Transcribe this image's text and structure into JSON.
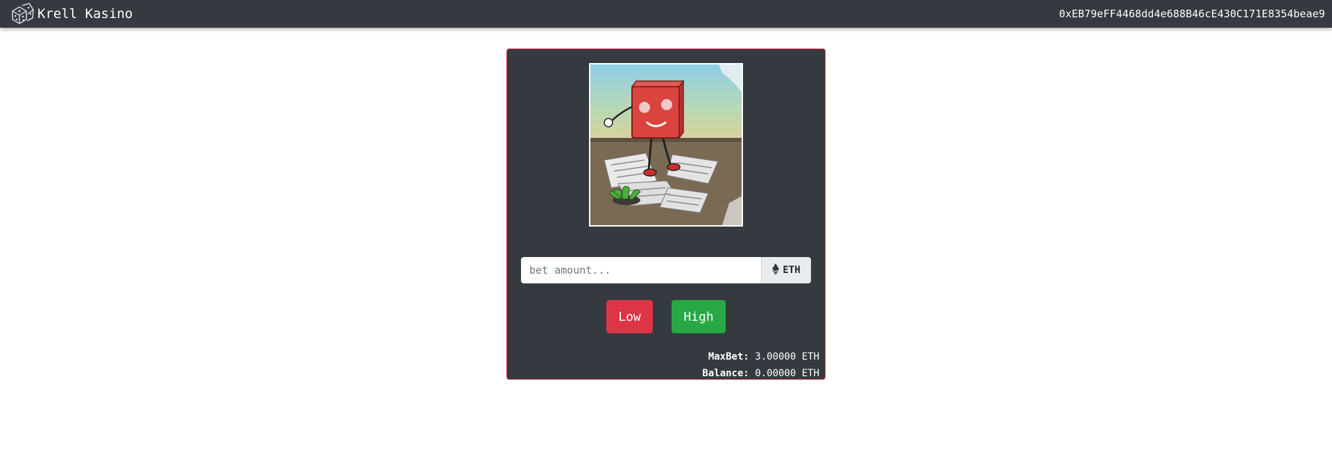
{
  "navbar": {
    "brand": "Krell Kasino",
    "brand_icon": "dice-icon",
    "wallet_address": "0xEB79eFF4468dd4e688B46cE430C171E8354beae9"
  },
  "game": {
    "image_icon": "dice-character-illustration",
    "bet_placeholder": "bet amount...",
    "bet_value": "",
    "currency": "ETH",
    "currency_icon": "ethereum-icon",
    "low_label": "Low",
    "high_label": "High",
    "maxbet_label": "MaxBet:",
    "maxbet_value": "3.00000 ETH",
    "balance_label": "Balance:",
    "balance_value": "0.00000 ETH"
  },
  "colors": {
    "navbar_bg": "#343a40",
    "card_border": "#dc3545",
    "low_button": "#dc3545",
    "high_button": "#28a745"
  }
}
